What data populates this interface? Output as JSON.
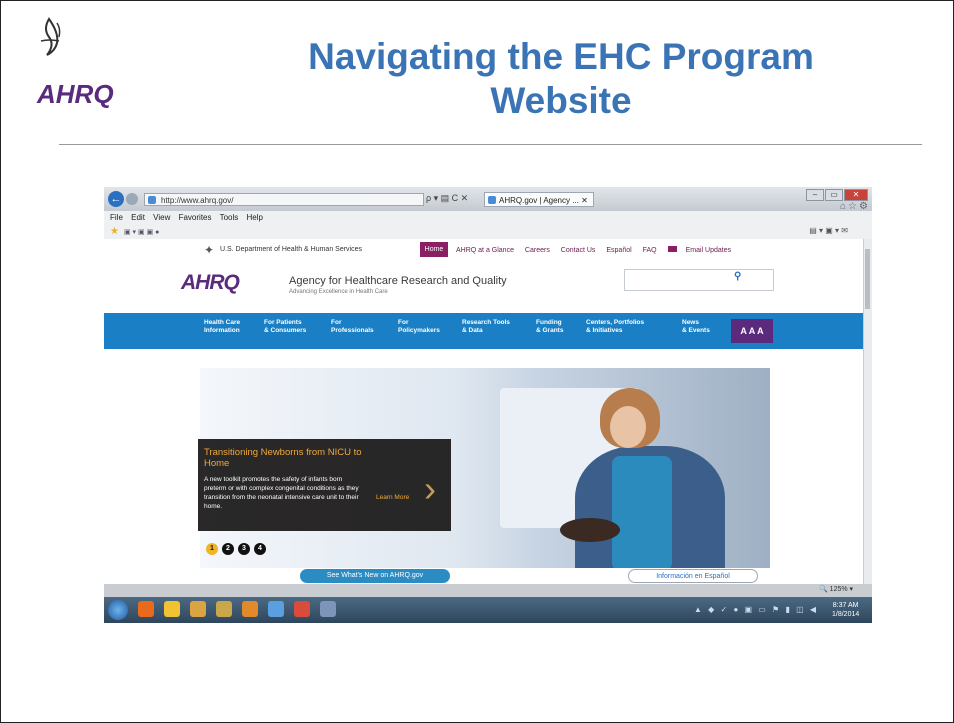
{
  "slide": {
    "title": "Navigating the EHC Program Website",
    "logo_text": "AHRQ"
  },
  "browser": {
    "back_glyph": "←",
    "address": "http://www.ahrq.gov/",
    "address_tools": "ρ ▾ ▤ C ✕",
    "tab_title": "AHRQ.gov | Agency ... ✕",
    "window_buttons": [
      "–",
      "▭",
      "✕"
    ],
    "right_icons": "⌂☆⚙",
    "menu": [
      "File",
      "Edit",
      "View",
      "Favorites",
      "Tools",
      "Help"
    ],
    "commands": "▤ ▾ ▣ ▾ ✉"
  },
  "site": {
    "hhs_label": "U.S. Department of Health & Human Services",
    "top_links": [
      "AHRQ at a Glance",
      "Careers",
      "Contact Us",
      "Español",
      "FAQ",
      "Email Updates"
    ],
    "home": "Home",
    "brand": "AHRQ",
    "agency": "Agency for Healthcare Research and Quality",
    "tagline": "Advancing Excellence in Health Care",
    "nav": [
      {
        "line1": "Health Care",
        "line2": "Information"
      },
      {
        "line1": "For Patients",
        "line2": "& Consumers"
      },
      {
        "line1": "For",
        "line2": "Professionals"
      },
      {
        "line1": "For",
        "line2": "Policymakers"
      },
      {
        "line1": "Research Tools",
        "line2": "& Data"
      },
      {
        "line1": "Funding",
        "line2": "& Grants"
      },
      {
        "line1": "Centers, Portfolios",
        "line2": "& Initiatives"
      },
      {
        "line1": "News",
        "line2": "& Events"
      }
    ],
    "text_size": "A A A",
    "hero": {
      "title": "Transitioning Newborns from NICU to Home",
      "body": "A new toolkit promotes the safety of infants born preterm or with complex congenital conditions as they transition from the neonatal intensive care unit to their home.",
      "cta": "Learn More",
      "slides": [
        "1",
        "2",
        "3",
        "4"
      ],
      "active_slide": 1
    },
    "bottom_left_button": "See What's New on AHRQ.gov",
    "bottom_right_button": "Información en Español"
  },
  "status": {
    "zoom": "125%"
  },
  "taskbar": {
    "time": "8:37 AM",
    "date": "1/8/2014",
    "tray": "▲ ◆ ✓ ● ▣ ▭ ⚑ ▮ ◫ ◀"
  }
}
